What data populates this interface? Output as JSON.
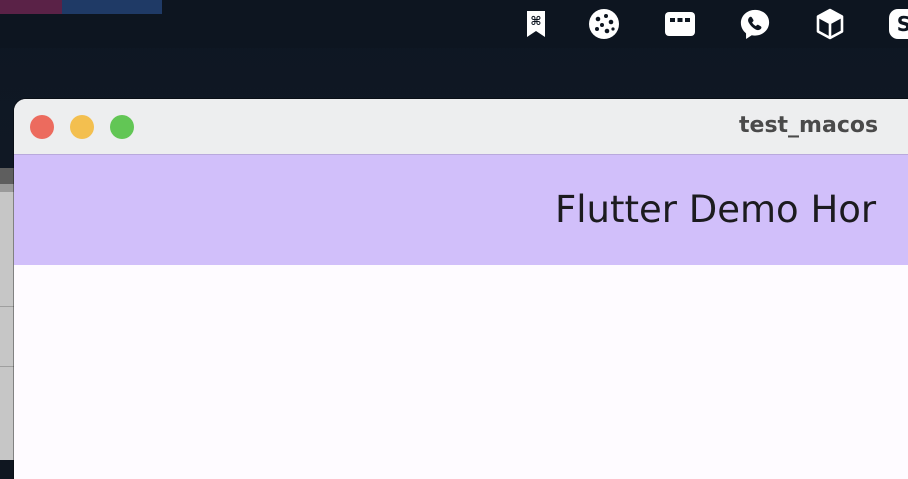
{
  "menubar": {
    "status_icons": [
      "keyboard-shortcut-bookmark-icon",
      "cookie-icon",
      "keyboard-icon",
      "viber-icon",
      "box-icon",
      "skype-icon"
    ]
  },
  "window": {
    "title": "test_macos",
    "traffic_lights": {
      "close": "#ec6b5e",
      "minimize": "#f3bf4f",
      "zoom": "#62c655"
    }
  },
  "appbar": {
    "title": "Flutter Demo Hor",
    "background": "#d1bffa"
  },
  "colors": {
    "desktop": "#0f1620",
    "titlebar": "#edeeef",
    "content": "#fefbff"
  }
}
